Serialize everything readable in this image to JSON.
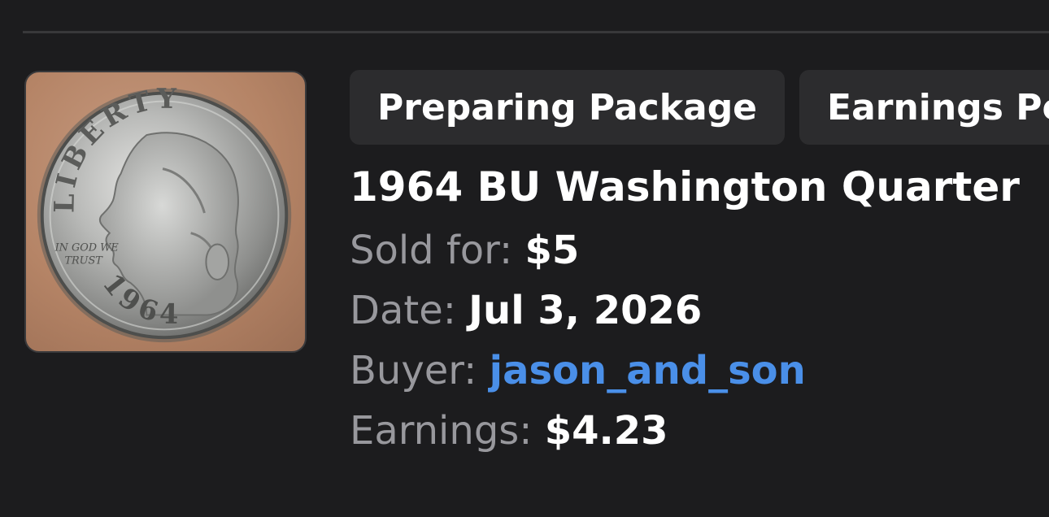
{
  "chips": [
    {
      "label": "Preparing Package"
    },
    {
      "label": "Earnings Pending"
    }
  ],
  "item": {
    "image_icon": "coin-photo",
    "title": "1964 BU Washington Quarter",
    "sold_for_label": "Sold for:",
    "sold_for_value": "$5",
    "date_label": "Date:",
    "date_value": "Jul 3, 2026",
    "buyer_label": "Buyer:",
    "buyer_value": "jason_and_son",
    "earnings_label": "Earnings:",
    "earnings_value": "$4.23"
  },
  "coin": {
    "legend": "LIBERTY",
    "motto_line1": "IN GOD WE",
    "motto_line2": "TRUST",
    "year": "1964"
  },
  "colors": {
    "background": "#1c1c1e",
    "chip": "#2c2c2e",
    "label": "#98989d",
    "link": "#4a8fe8"
  }
}
